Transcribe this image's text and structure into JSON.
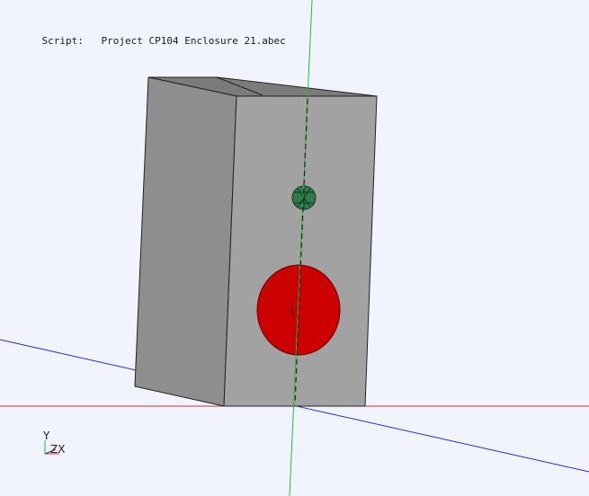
{
  "header": {
    "script_label": "Script:",
    "script_value": "Project CP104 Enclosure 21.abec"
  },
  "triad": {
    "y_label": "Y",
    "zx_label": "ZX"
  },
  "colors": {
    "background": "#f1f4fe",
    "x_axis": "#d21e1e",
    "y_axis": "#1ec81e",
    "z_axis": "#1e1ed2",
    "enclosure_front": "#a0a0a0",
    "enclosure_side": "#8c8c8c",
    "enclosure_top": "#7a7a7a",
    "woofer": "#cc0000",
    "tweeter": "#2e7d4a"
  },
  "icons": {
    "triad": "axes-triad-icon"
  }
}
